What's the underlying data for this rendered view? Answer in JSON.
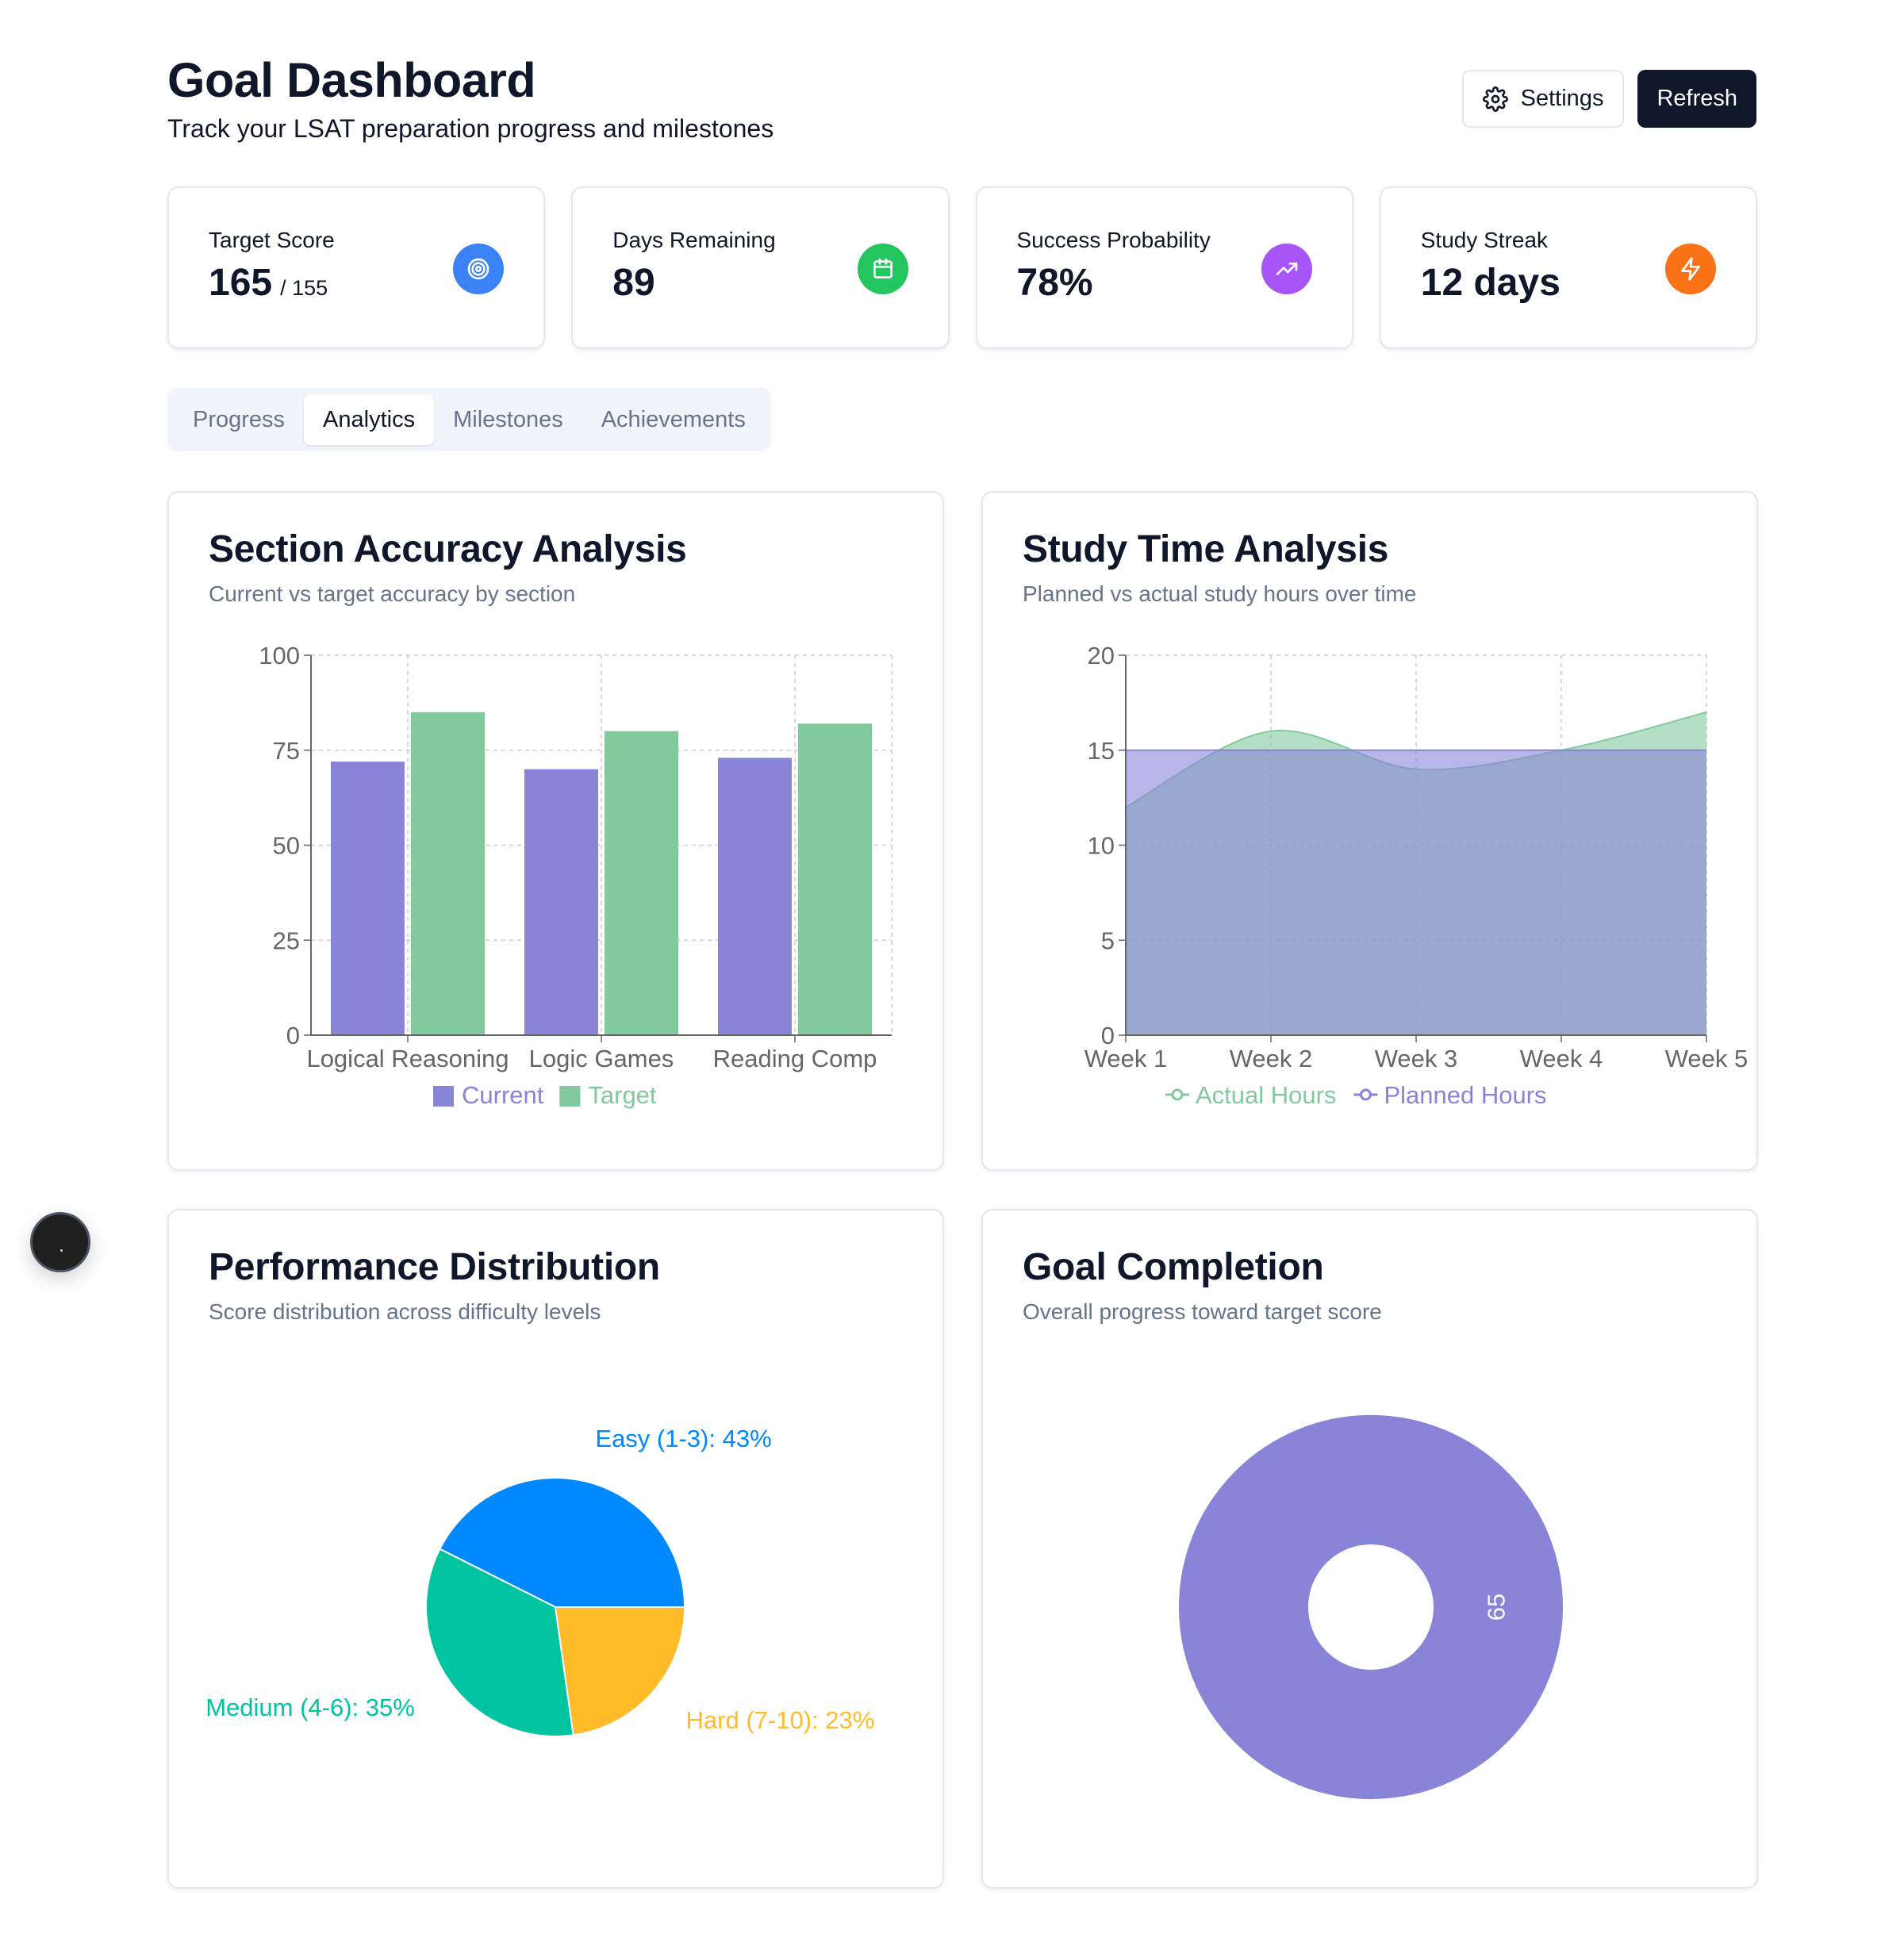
{
  "header": {
    "title": "Goal Dashboard",
    "subtitle": "Track your LSAT preparation progress and milestones",
    "settings_label": "Settings",
    "refresh_label": "Refresh"
  },
  "stats": [
    {
      "label": "Target Score",
      "value": "165",
      "sub": "/ 155",
      "icon": "target-icon",
      "color": "#3b82f6"
    },
    {
      "label": "Days Remaining",
      "value": "89",
      "icon": "calendar-icon",
      "color": "#22c55e"
    },
    {
      "label": "Success Probability",
      "value": "78%",
      "icon": "trending-up-icon",
      "color": "#a855f7"
    },
    {
      "label": "Study Streak",
      "value": "12 days",
      "icon": "lightning-icon",
      "color": "#f97316"
    }
  ],
  "tabs": [
    {
      "label": "Progress",
      "active": false
    },
    {
      "label": "Analytics",
      "active": true
    },
    {
      "label": "Milestones",
      "active": false
    },
    {
      "label": "Achievements",
      "active": false
    }
  ],
  "panels": {
    "accuracy": {
      "title": "Section Accuracy Analysis",
      "subtitle": "Current vs target accuracy by section"
    },
    "study_time": {
      "title": "Study Time Analysis",
      "subtitle": "Planned vs actual study hours over time"
    },
    "distribution": {
      "title": "Performance Distribution",
      "subtitle": "Score distribution across difficulty levels"
    },
    "completion": {
      "title": "Goal Completion",
      "subtitle": "Overall progress toward target score"
    }
  },
  "colors": {
    "current": "#8884d8",
    "target": "#82ca9d",
    "easy": "#0088fe",
    "medium": "#00c49f",
    "hard": "#ffbb28"
  },
  "chart_data": [
    {
      "type": "bar",
      "categories": [
        "Logical Reasoning",
        "Logic Games",
        "Reading Comp"
      ],
      "series": [
        {
          "name": "Current",
          "values": [
            72,
            70,
            73
          ]
        },
        {
          "name": "Target",
          "values": [
            85,
            80,
            82
          ]
        }
      ],
      "ylim": [
        0,
        100
      ],
      "yticks": [
        "0",
        "25",
        "50",
        "75",
        "100"
      ],
      "grid": true,
      "legend": "bottom"
    },
    {
      "type": "area",
      "categories": [
        "Week 1",
        "Week 2",
        "Week 3",
        "Week 4",
        "Week 5"
      ],
      "series": [
        {
          "name": "Actual Hours",
          "values": [
            12,
            16,
            14,
            15,
            17
          ]
        },
        {
          "name": "Planned Hours",
          "values": [
            15,
            15,
            15,
            15,
            15
          ]
        }
      ],
      "ylim": [
        0,
        20
      ],
      "yticks": [
        "0",
        "5",
        "10",
        "15",
        "20"
      ],
      "grid": true,
      "legend": "bottom"
    },
    {
      "type": "pie",
      "slices": [
        {
          "label": "Easy (1-3): 43%",
          "value": 43
        },
        {
          "label": "Medium (4-6): 35%",
          "value": 35
        },
        {
          "label": "Hard (7-10): 23%",
          "value": 23
        }
      ]
    },
    {
      "type": "pie",
      "slices": [
        {
          "label": "65",
          "value": 65
        }
      ]
    }
  ]
}
